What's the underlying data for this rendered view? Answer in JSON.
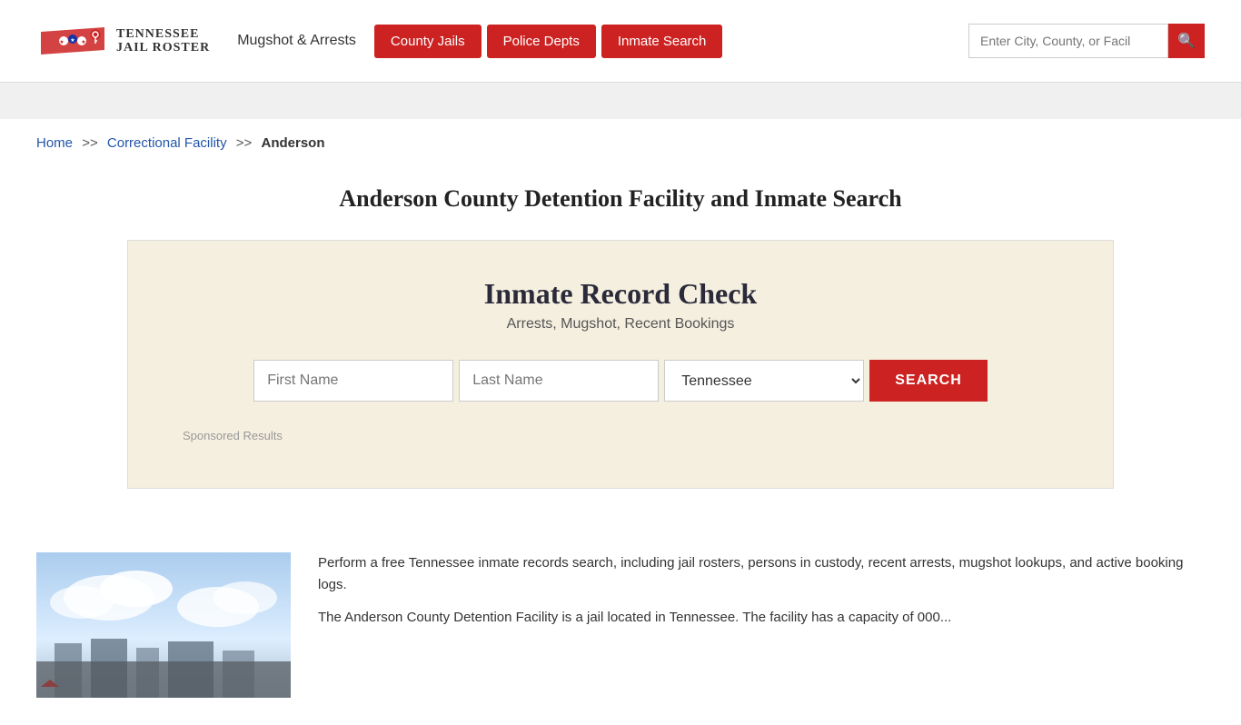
{
  "header": {
    "logo_state": "TENNESSEE",
    "logo_subtitle": "JAIL ROSTER",
    "mugshot_link": "Mugshot & Arrests",
    "nav_buttons": [
      {
        "label": "County Jails",
        "id": "county-jails"
      },
      {
        "label": "Police Depts",
        "id": "police-depts"
      },
      {
        "label": "Inmate Search",
        "id": "inmate-search"
      }
    ],
    "search_placeholder": "Enter City, County, or Facil"
  },
  "breadcrumb": {
    "home": "Home",
    "sep1": ">>",
    "facility": "Correctional Facility",
    "sep2": ">>",
    "current": "Anderson"
  },
  "page_title": "Anderson County Detention Facility and Inmate Search",
  "inmate_record": {
    "title": "Inmate Record Check",
    "subtitle": "Arrests, Mugshot, Recent Bookings",
    "first_name_placeholder": "First Name",
    "last_name_placeholder": "Last Name",
    "state_default": "Tennessee",
    "search_button": "SEARCH",
    "sponsored_label": "Sponsored Results"
  },
  "bottom_content": {
    "para1": "Perform a free Tennessee inmate records search, including jail rosters, persons in custody, recent arrests, mugshot lookups, and active booking logs.",
    "para2": "The Anderson County Detention Facility is a jail located in Tennessee. The facility has a capacity of 000..."
  },
  "colors": {
    "nav_red": "#cc2222",
    "link_blue": "#2255aa",
    "box_bg": "#f5efe0"
  }
}
